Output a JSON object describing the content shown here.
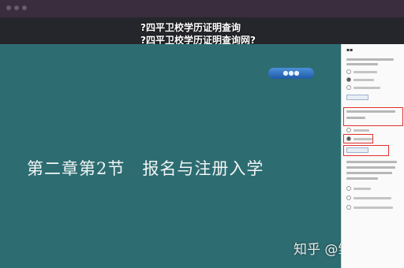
{
  "caption": {
    "line1": "?四平卫校学历证明查询",
    "line2": "?四平卫校学历证明查询网?"
  },
  "slide": {
    "title": "第二章第2节　报名与注册入学",
    "watermark": "知乎 @雏菊Kath"
  },
  "colors": {
    "slide_bg": "#2d6d72",
    "panel_bg": "#fafafa",
    "highlight": "#e0302e"
  }
}
